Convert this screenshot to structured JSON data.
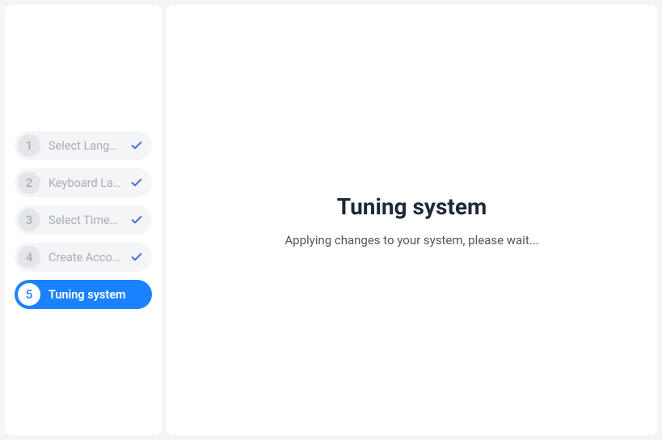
{
  "sidebar": {
    "steps": [
      {
        "number": "1",
        "label": "Select Langu…",
        "completed": true,
        "active": false
      },
      {
        "number": "2",
        "label": "Keyboard La…",
        "completed": true,
        "active": false
      },
      {
        "number": "3",
        "label": "Select Timez…",
        "completed": true,
        "active": false
      },
      {
        "number": "4",
        "label": "Create Accou…",
        "completed": true,
        "active": false
      },
      {
        "number": "5",
        "label": "Tuning system",
        "completed": false,
        "active": true
      }
    ]
  },
  "main": {
    "title": "Tuning system",
    "message": "Applying changes to your system, please wait..."
  }
}
